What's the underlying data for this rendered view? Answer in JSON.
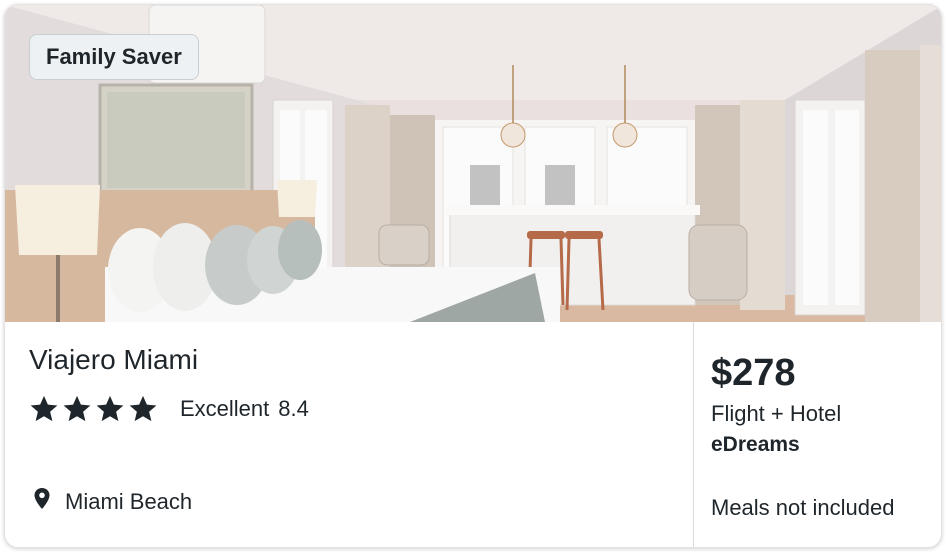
{
  "badge": {
    "label": "Family Saver"
  },
  "hotel": {
    "name": "Viajero Miami",
    "stars": 4,
    "rating_label": "Excellent",
    "rating_score": "8.4",
    "location": "Miami Beach"
  },
  "offer": {
    "price": "$278",
    "package": "Flight + Hotel",
    "provider": "eDreams",
    "meals": "Meals not included"
  },
  "icons": {
    "star": "star-icon",
    "location": "location-pin-icon"
  },
  "colors": {
    "text": "#1f262b",
    "badge_bg": "#eef1f3",
    "divider": "#d9dcdf"
  }
}
